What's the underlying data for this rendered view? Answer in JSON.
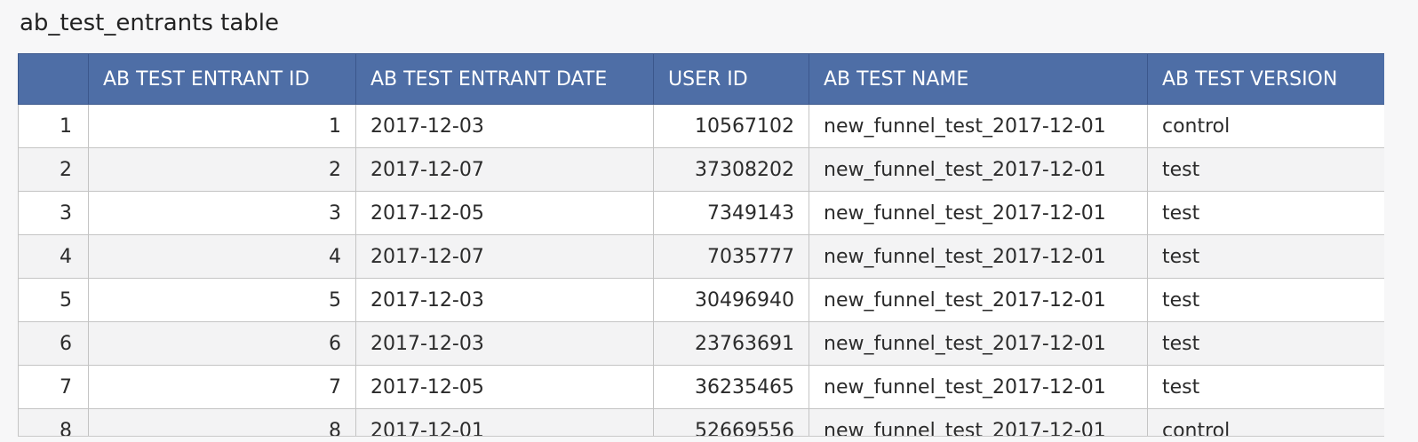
{
  "title": "ab_test_entrants table",
  "table": {
    "columns": [
      "",
      "AB TEST ENTRANT ID",
      "AB TEST ENTRANT DATE",
      "USER ID",
      "AB TEST NAME",
      "AB TEST VERSION"
    ],
    "rows": [
      [
        "1",
        "1",
        "2017-12-03",
        "10567102",
        "new_funnel_test_2017-12-01",
        "control"
      ],
      [
        "2",
        "2",
        "2017-12-07",
        "37308202",
        "new_funnel_test_2017-12-01",
        "test"
      ],
      [
        "3",
        "3",
        "2017-12-05",
        "7349143",
        "new_funnel_test_2017-12-01",
        "test"
      ],
      [
        "4",
        "4",
        "2017-12-07",
        "7035777",
        "new_funnel_test_2017-12-01",
        "test"
      ],
      [
        "5",
        "5",
        "2017-12-03",
        "30496940",
        "new_funnel_test_2017-12-01",
        "test"
      ],
      [
        "6",
        "6",
        "2017-12-03",
        "23763691",
        "new_funnel_test_2017-12-01",
        "test"
      ],
      [
        "7",
        "7",
        "2017-12-05",
        "36235465",
        "new_funnel_test_2017-12-01",
        "test"
      ],
      [
        "8",
        "8",
        "2017-12-01",
        "52669556",
        "new_funnel_test_2017-12-01",
        "control"
      ]
    ]
  }
}
